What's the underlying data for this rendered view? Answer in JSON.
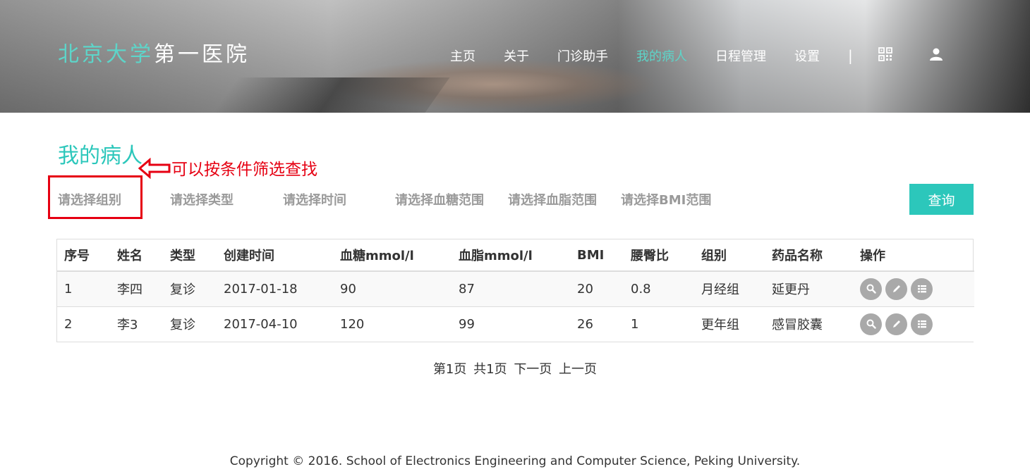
{
  "header": {
    "logo_part1": "北京大学",
    "logo_part2": "第一医院",
    "nav": [
      {
        "label": "主页",
        "active": false
      },
      {
        "label": "关于",
        "active": false
      },
      {
        "label": "门诊助手",
        "active": false
      },
      {
        "label": "我的病人",
        "active": true
      },
      {
        "label": "日程管理",
        "active": false
      },
      {
        "label": "设置",
        "active": false
      }
    ],
    "separator": "|",
    "icons": [
      "qrcode-icon",
      "user-icon"
    ],
    "accent_color": "#5dd5c9"
  },
  "page": {
    "title": "我的病人",
    "annotation": "可以按条件筛选查找",
    "annotation_color": "#e60012"
  },
  "filters": {
    "group": "请选择组别",
    "type": "请选择类型",
    "time": "请选择时间",
    "glucose": "请选择血糖范围",
    "lipid": "请选择血脂范围",
    "bmi": "请选择BMI范围",
    "query_button": "查询"
  },
  "table": {
    "columns": [
      "序号",
      "姓名",
      "类型",
      "创建时间",
      "血糖mmol/l",
      "血脂mmol/l",
      "BMI",
      "腰臀比",
      "组别",
      "药品名称",
      "操作"
    ],
    "rows": [
      {
        "no": "1",
        "name": "李四",
        "type": "复诊",
        "created": "2017-01-18",
        "glucose": "90",
        "lipid": "87",
        "bmi": "20",
        "whr": "0.8",
        "group": "月经组",
        "drug": "延更丹"
      },
      {
        "no": "2",
        "name": "李3",
        "type": "复诊",
        "created": "2017-04-10",
        "glucose": "120",
        "lipid": "99",
        "bmi": "26",
        "whr": "1",
        "group": "更年组",
        "drug": "感冒胶囊"
      }
    ],
    "row_actions": [
      "search-icon",
      "edit-icon",
      "list-icon"
    ]
  },
  "pagination": {
    "current": "第1页",
    "total": "共1页",
    "next": "下一页",
    "prev": "上一页"
  },
  "footer": {
    "copyright": "Copyright © 2016. School of Electronics Engineering and Computer Science, Peking University."
  }
}
